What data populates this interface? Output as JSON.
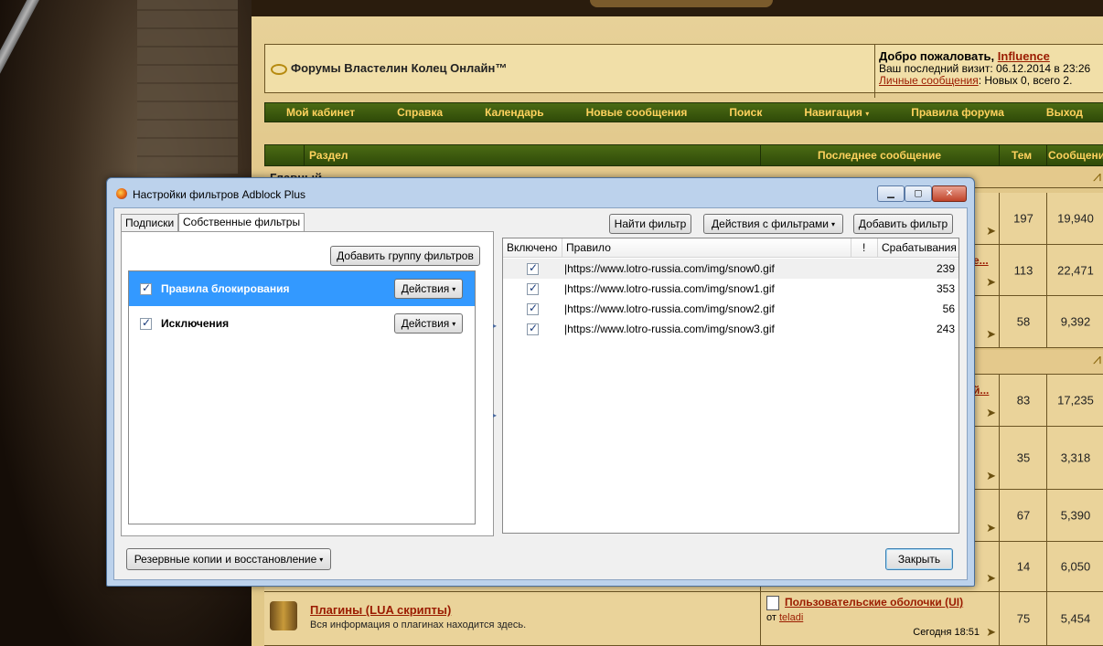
{
  "forum": {
    "title": "Форумы Властелин Колец Онлайн™",
    "welcome_prefix": "Добро пожаловать, ",
    "username": "Influence",
    "last_visit": "Ваш последний визит: 06.12.2014 в 23:26",
    "pm_link": "Личные сообщения",
    "pm_stats": ": Новых 0, всего 2.",
    "nav": [
      "Мой кабинет",
      "Справка",
      "Календарь",
      "Новые сообщения",
      "Поиск",
      "Навигация",
      "Правила форума",
      "Выход"
    ],
    "columns": {
      "section": "Раздел",
      "last_post": "Последнее сообщение",
      "topics": "Тем",
      "posts": "Сообщений"
    },
    "category": "Главный",
    "rows": [
      {
        "topics": "197",
        "posts": "19,940"
      },
      {
        "topics": "113",
        "posts": "22,471",
        "trunc": "е..."
      },
      {
        "topics": "58",
        "posts": "9,392"
      },
      {
        "topics": "83",
        "posts": "17,235",
        "trunc": "й..."
      },
      {
        "topics": "35",
        "posts": "3,318"
      },
      {
        "topics": "67",
        "posts": "5,390"
      },
      {
        "topics": "14",
        "posts": "6,050"
      }
    ],
    "plugin": {
      "title": "Плагины (LUA скрипты)",
      "desc": "Вся информация о плагинах находится здесь.",
      "last_title": "Пользовательские оболочки (UI)",
      "by": "от ",
      "author": "teladi",
      "time": "Сегодня 18:51",
      "topics": "75",
      "posts": "5,454"
    }
  },
  "dialog": {
    "title": "Настройки фильтров Adblock Plus",
    "tabs": [
      "Подписки",
      "Собственные фильтры"
    ],
    "add_group": "Добавить группу фильтров",
    "groups": [
      {
        "name": "Правила блокирования",
        "action": "Действия",
        "checked": "✓"
      },
      {
        "name": "Исключения",
        "action": "Действия",
        "checked": "✓"
      }
    ],
    "find_filter": "Найти фильтр",
    "filter_actions": "Действия с фильтрами",
    "add_filter": "Добавить фильтр",
    "columns": {
      "enabled": "Включено",
      "rule": "Правило",
      "bang": "!",
      "hits": "Срабатывания"
    },
    "rules": [
      {
        "rule": "|https://www.lotro-russia.com/img/snow0.gif",
        "hits": "239",
        "checked": "✓"
      },
      {
        "rule": "|https://www.lotro-russia.com/img/snow1.gif",
        "hits": "353",
        "checked": "✓"
      },
      {
        "rule": "|https://www.lotro-russia.com/img/snow2.gif",
        "hits": "56",
        "checked": "✓"
      },
      {
        "rule": "|https://www.lotro-russia.com/img/snow3.gif",
        "hits": "243",
        "checked": "✓"
      }
    ],
    "backup": "Резервные копии и восстановление",
    "close": "Закрыть"
  }
}
